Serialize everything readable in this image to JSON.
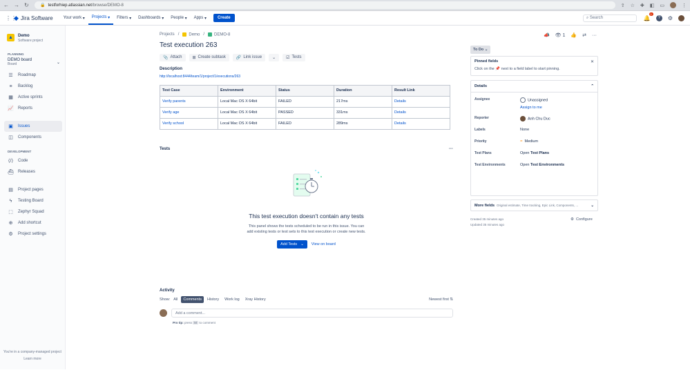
{
  "browser": {
    "host": "testforhiep.atlassian.net",
    "path": "/browse/DEMO-8"
  },
  "topbar": {
    "logo": "Jira Software",
    "menu": [
      "Your work",
      "Projects",
      "Filters",
      "Dashboards",
      "People",
      "Apps"
    ],
    "active_menu": "Projects",
    "create": "Create",
    "search_placeholder": "Search",
    "notif_count": "1",
    "help": "?"
  },
  "sidebar": {
    "project_name": "Demo",
    "project_type": "Software project",
    "planning_label": "PLANNING",
    "board_title": "DEMO board",
    "board_sub": "Board",
    "planning_items": [
      "Roadmap",
      "Backlog",
      "Active sprints",
      "Reports"
    ],
    "issues_items": [
      "Issues",
      "Components"
    ],
    "dev_label": "DEVELOPMENT",
    "dev_items": [
      "Code",
      "Releases"
    ],
    "other_items": [
      "Project pages",
      "Testing Board",
      "Zephyr Squad",
      "Add shortcut",
      "Project settings"
    ],
    "footer_text": "You're in a company-managed project",
    "footer_link": "Learn more"
  },
  "breadcrumb": [
    "Projects",
    "Demo",
    "DEMO-8"
  ],
  "issue": {
    "title": "Test execution 263",
    "actions": [
      "Attach",
      "Create subtask",
      "Link issue",
      "Tests"
    ],
    "description_label": "Description",
    "description_link": "http://localhost:8444/team/1/project/1/executions/263"
  },
  "table": {
    "headers": [
      "Test Case",
      "Environment",
      "Status",
      "Duration",
      "Result Link"
    ],
    "rows": [
      [
        "Verify parents",
        "Local Mac OS X 64bit",
        "FAILED",
        "217ms",
        "Details"
      ],
      [
        "Verify age",
        "Local Mac OS X 64bit",
        "PASSED",
        "331ms",
        "Details"
      ],
      [
        "Verify school",
        "Local Mac OS X 64bit",
        "FAILED",
        "289ms",
        "Details"
      ]
    ]
  },
  "tests_panel": {
    "title": "Tests",
    "more": "···",
    "empty_title": "This test execution doesn't contain any tests",
    "empty_text_1": "This panel shows the tests scheduled to be run in this issue. You can",
    "empty_text_2": "add existing tests or test sets to this test execution or create new tests.",
    "add_tests": "Add Tests",
    "view_board": "View on board"
  },
  "activity": {
    "title": "Activity",
    "show": "Show:",
    "filters": [
      "All",
      "Comments",
      "History",
      "Work log",
      "Xray History"
    ],
    "active_filter": "Comments",
    "sort": "Newest first",
    "comment_placeholder": "Add a comment...",
    "pro_tip": "Pro tip:",
    "press": "press",
    "key": "M",
    "to_comment": "to comment"
  },
  "right": {
    "watchers": "1",
    "status": "To Do",
    "pinned_title": "Pinned fields",
    "pinned_text_1": "Click on the",
    "pinned_text_2": "next to a field label to start pinning.",
    "details_title": "Details",
    "fields": {
      "assignee_label": "Assignee",
      "assignee": "Unassigned",
      "assign_me": "Assign to me",
      "reporter_label": "Reporter",
      "reporter": "Anh Chu Duc",
      "labels_label": "Labels",
      "labels": "None",
      "priority_label": "Priority",
      "priority": "Medium",
      "plans_label": "Test Plans",
      "plans_open": "Open",
      "plans": "Test Plans",
      "env_label": "Test Environments",
      "env_open": "Open",
      "env": "Test Environments"
    },
    "more_fields": "More fields",
    "more_fields_sub": "Original estimate, Time tracking, Epic Link, Components, ...",
    "created": "Created 35 minutes ago",
    "updated": "Updated 35 minutes ago",
    "configure": "Configure"
  }
}
